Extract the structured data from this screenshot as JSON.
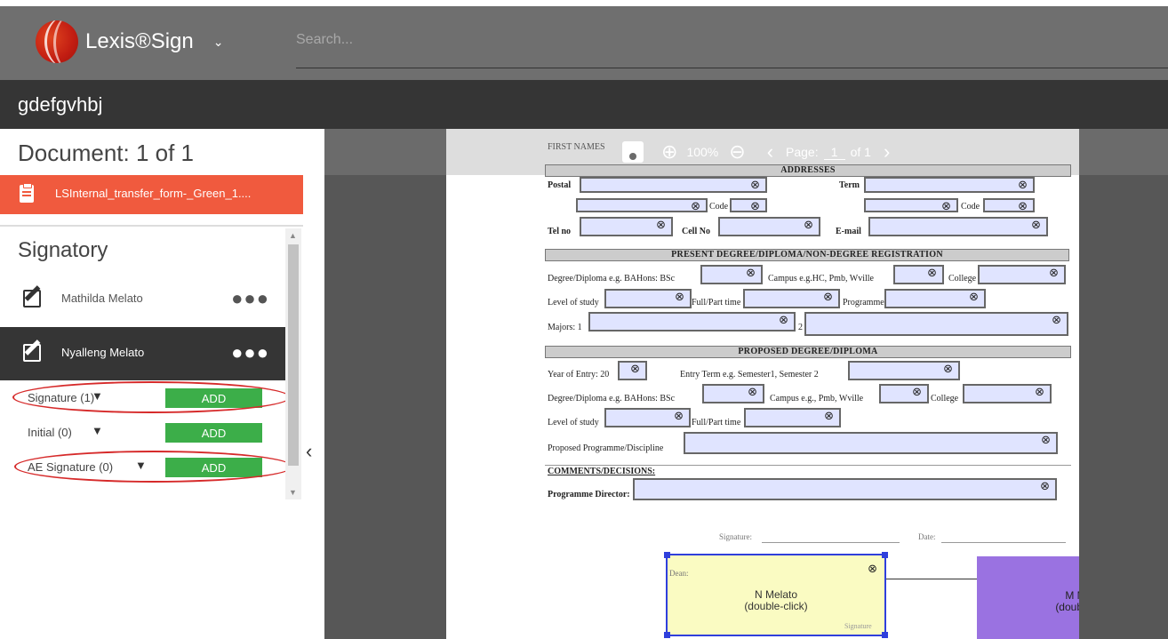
{
  "header": {
    "brand": "Lexis®Sign",
    "chevron": "⌄",
    "search_placeholder": "Search..."
  },
  "title": "gdefgvhbj",
  "sidebar": {
    "doc_count": "Document: 1 of 1",
    "document_name": "LSInternal_transfer_form-_Green_1....",
    "signatory_heading": "Signatory",
    "signers": [
      {
        "name": "Mathilda Melato",
        "more": "●●●"
      },
      {
        "name": "Nyalleng Melato",
        "more": "●●●"
      }
    ],
    "fields": [
      {
        "label": "Signature (1)",
        "caret": "▼",
        "button": "ADD"
      },
      {
        "label": "Initial (0)",
        "caret": "▼",
        "button": "ADD"
      },
      {
        "label": "AE Signature (0)",
        "caret": "▼",
        "button": "ADD"
      }
    ],
    "collapse_icon": "‹"
  },
  "toolbar": {
    "zoom_in": "⊕",
    "zoom_level": "100%",
    "zoom_out": "⊖",
    "prev": "‹",
    "page_label": "Page:",
    "page_value": "1",
    "page_of": "of 1",
    "next": "›"
  },
  "form": {
    "first_names": "FIRST NAMES",
    "addresses": "ADDRESSES",
    "postal": "Postal",
    "term": "Term",
    "code1": "Code",
    "code2": "Code",
    "tel_no": "Tel no",
    "cell_no": "Cell No",
    "email": "E-mail",
    "present_degree": "PRESENT DEGREE/DIPLOMA/NON-DEGREE REGISTRATION",
    "degree_label1": "Degree/Diploma e.g. BAHons: BSc",
    "campus_label1": "Campus e.g.HC, Pmb, Wville",
    "college1": "College",
    "level1": "Level of study",
    "fullpart1": "Full/Part time",
    "programme": "Programme",
    "majors": "Majors: 1",
    "majors2": "2",
    "proposed_degree": "PROPOSED DEGREE/DIPLOMA",
    "year_of_entry": "Year of Entry: 20",
    "entry_term": "Entry Term e.g. Semester1, Semester 2",
    "degree_label2": "Degree/Diploma e.g. BAHons: BSc",
    "campus_label2": "Campus e.g., Pmb, Wville",
    "college2": "College",
    "level2": "Level of study",
    "fullpart2": "Full/Part time",
    "proposed_programme": "Proposed Programme/Discipline",
    "comments": "COMMENTS/DECISIONS:",
    "programme_director": "Programme Director:",
    "signature_label": "Signature:",
    "date_label": "Date:",
    "dean_label": "Dean:",
    "signature_small": "Signature",
    "remove_icon": "⊗"
  },
  "signatures": [
    {
      "name": "N Melato",
      "hint": "(double-click)"
    },
    {
      "name": "M Melato",
      "hint": "(double-click)"
    }
  ]
}
